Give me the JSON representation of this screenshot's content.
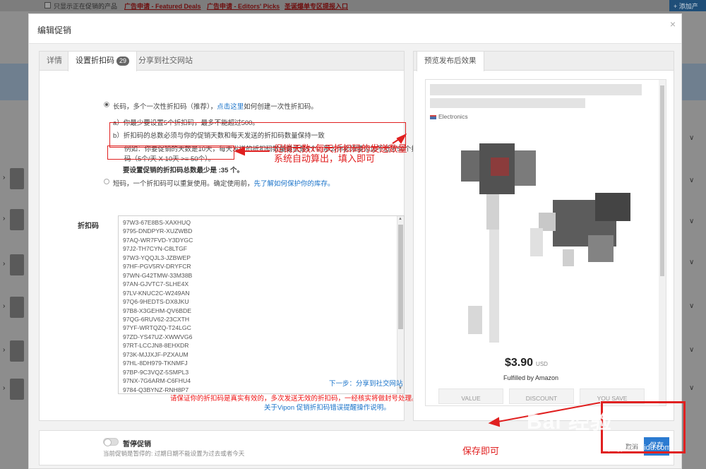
{
  "background": {
    "show_only_checkbox_label": "只显示正在促销的产品",
    "links": [
      "广告申请 - Featured Deals",
      "广告申请 - Editors' Picks",
      "圣诞爆单专区提报入口"
    ],
    "add_button": "+ 添加产"
  },
  "modal": {
    "title": "编辑促销",
    "close": "×"
  },
  "tabs": [
    {
      "label": "详情"
    },
    {
      "label": "设置折扣码",
      "badge": "29"
    },
    {
      "label": "分享到社交网站"
    }
  ],
  "form": {
    "option_long_prefix": "长码，多个一次性折扣码（推荐），",
    "option_long_link": "点击这里",
    "option_long_suffix": "如何创建一次性折扣码。",
    "rule_a": "a）你最少要设置5个折扣码，最多不能超过500。",
    "rule_b": "b）折扣码的总数必须与你的促销天数和每天发送的折扣码数量保持一致",
    "example_line1": "例如：你要促销的天数是10天，每天发送的折扣码数量最低是5个，那么你必须要添加不低于50个折扣",
    "example_line2": "码（5个/天 X 10天 >= 50个）。",
    "min_codes": "要设置促销的折扣码总数最少是 :35 个。",
    "option_short_prefix": "短码，一个折扣码可以重复使用。确定使用前，",
    "option_short_link": "先了解如何保护你的库存。",
    "codes_label": "折扣码",
    "codes": [
      "97W3-67E8BS-XAXHUQ",
      "9795-DNDPYR-XUZWBD",
      "97AQ-WR7FVD-Y3DYGC",
      "97J2-TH7CYN-C8LTGF",
      "97W3-YQQJL3-JZBWEP",
      "97HF-PGV5RV-DRYFCR",
      "97WN-G42TMW-33M38B",
      "97AN-GJVTC7-SLHE4X",
      "97LV-KNUC2C-W249AN",
      "97Q6-9HEDTS-DX8JKU",
      "97B8-X3GEHM-QV6BDE",
      "97QG-6RUV62-23CXTH",
      "97YF-WRTQZQ-T24LGC",
      "97ZD-YS47UZ-XWWVG6",
      "97RT-LCCJN8-8EHXDR",
      "973K-MJJXJF-PZXAUM",
      "97HL-8DH979-TKNMFJ",
      "97BP-9C3VQZ-5SMPL3",
      "97NX-7G6ARM-C6FHU4",
      "9784-Q3BYNZ-RNH8P7"
    ],
    "next_step": "下一步：分享到社交网站",
    "warning": "请保证你的折扣码是真实有效的，多次发送无效的折扣码，一经核实将做封号处理。",
    "warning_link": "关于Vipon 促销折扣码错误提醒操作说明。"
  },
  "preview": {
    "tab": "预览发布后效果",
    "category": "Electronics",
    "price": "$3.90",
    "currency": "USD",
    "fulfilled": "Fulfilled by Amazon",
    "buttons": [
      "VALUE",
      "DISCOUNT",
      "YOU SAVE"
    ]
  },
  "footer": {
    "pause_label": "暂停促销",
    "hint": "当前促销是暂停的: 过期日期不能设置为过去或者今天",
    "cancel": "取消",
    "save": "保存"
  },
  "annotations": {
    "note1_line1": "促销天数x每天折扣码的发送数量",
    "note1_line2": "系统自动算出，填入即可",
    "note2": "保存即可"
  },
  "watermark": {
    "brand": "Bai 经验",
    "url": "jingyan.baidu.com"
  },
  "colors": {
    "accent": "#2b7bd1",
    "annotation": "#e02020",
    "link": "#1a73c9"
  }
}
